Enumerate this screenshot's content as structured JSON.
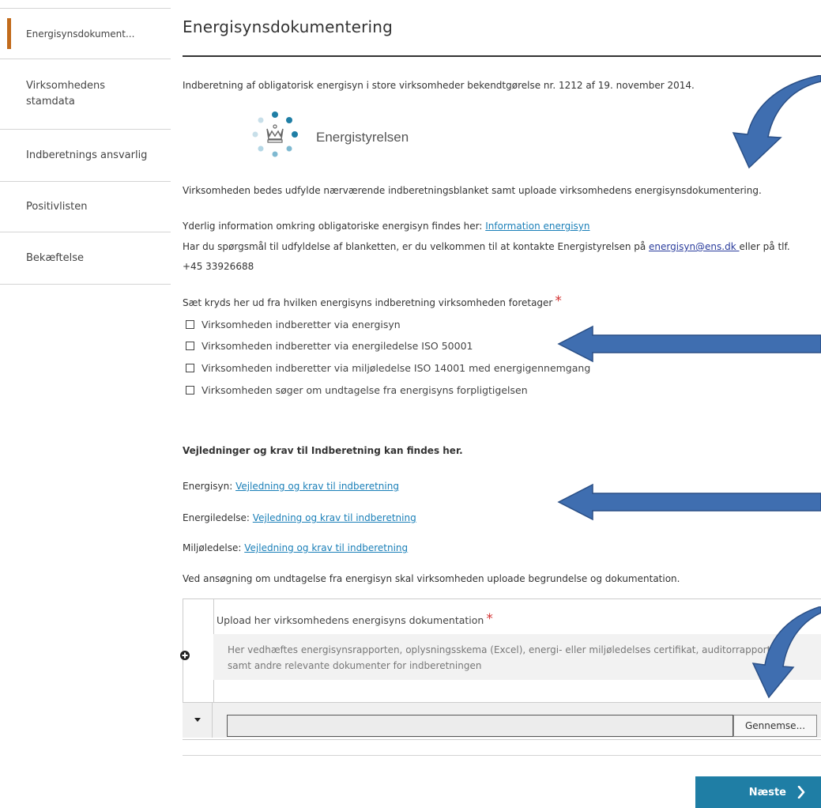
{
  "sidebar": {
    "items": [
      {
        "label": "Energisynsdokument..."
      },
      {
        "label": "Virksomhedens stamdata"
      },
      {
        "label": "Indberetnings ansvarlig"
      },
      {
        "label": "Positivlisten"
      },
      {
        "label": "Bekæftelse"
      }
    ]
  },
  "main": {
    "title": "Energisynsdokumentering",
    "intro": "Indberetning af obligatorisk energisyn i store virksomheder bekendtgørelse nr. 1212 af 19. november 2014.",
    "logo_text": "Energistyrelsen",
    "instruction": "Virksomheden bedes udfylde nærværende indberetningsblanket samt uploade virksomhedens energisynsdokumentering.",
    "info_prefix": "Yderlig information omkring obligatoriske energisyn findes her: ",
    "info_link": "Information energisyn",
    "contact_prefix": "Har du spørgsmål til udfyldelse af blanketten, er du velkommen til at kontakte Energistyrelsen på ",
    "contact_email": "energisyn@ens.dk ",
    "contact_suffix": "eller på tlf.",
    "contact_phone": "+45 33926688",
    "checkbox_question": "Sæt kryds her ud fra hvilken energisyns indberetning virksomheden foretager",
    "required_mark": "*",
    "options": [
      {
        "label": "Virksomheden indberetter via energisyn",
        "checked": false
      },
      {
        "label": "Virksomheden indberetter via energiledelse ISO 50001",
        "checked": false
      },
      {
        "label": "Virksomheden indberetter via miljøledelse ISO 14001 med energigennemgang",
        "checked": false
      },
      {
        "label": "Virksomheden søger om undtagelse fra energisyns forpligtigelsen",
        "checked": false
      }
    ],
    "guides_heading": "Vejledninger og krav til Indberetning kan findes her.",
    "guides": [
      {
        "prefix": "Energisyn: ",
        "link": "Vejledning og krav til indberetning"
      },
      {
        "prefix": "Energiledelse: ",
        "link": "Vejledning og krav til indberetning"
      },
      {
        "prefix": "Miljøledelse: ",
        "link": "Vejledning og krav til indberetning"
      }
    ],
    "exemption_note": "Ved ansøgning om undtagelse fra energisyn skal virksomheden uploade begrundelse og dokumentation."
  },
  "upload": {
    "title": "Upload her virksomhedens energisyns dokumentation",
    "help_line1": "Her vedhæftes energisynsrapporten, oplysningsskema (Excel), energi- eller miljøledelses certifikat, auditorrapport,",
    "help_line2": "samt andre relevante dokumenter for indberetningen",
    "file_value": "",
    "browse_label": "Gennemse..."
  },
  "footer": {
    "next_label": "Næste"
  },
  "colors": {
    "accent": "#c26b1c",
    "link": "#1a7fb8",
    "button": "#1f7ea5",
    "annotation_arrow": "#3f6eb0",
    "required": "#d32f2f"
  }
}
